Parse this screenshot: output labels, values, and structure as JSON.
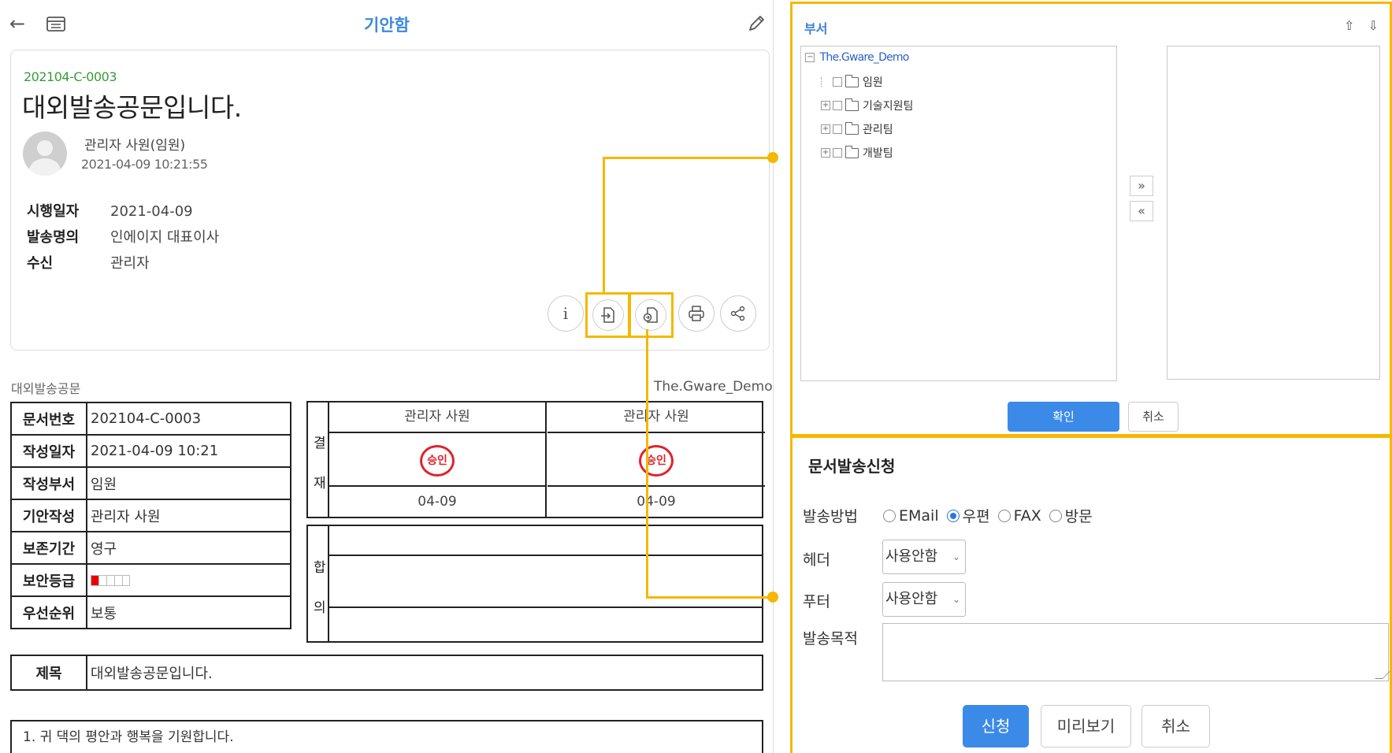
{
  "header": {
    "title": "기안함"
  },
  "document": {
    "code": "202104-C-0003",
    "title": "대외발송공문입니다.",
    "writer": "관리자 사원(임원)",
    "written_at": "2021-04-09 10:21:55",
    "meta": [
      {
        "key": "시행일자",
        "value": "2021-04-09"
      },
      {
        "key": "발송명의",
        "value": "인에이지 대표이사"
      },
      {
        "key": "수신",
        "value": "관리자"
      }
    ]
  },
  "form": {
    "label": "대외발송공문",
    "company": "The.Gware_Demo",
    "info_rows": [
      {
        "key": "문서번호",
        "value": "202104-C-0003"
      },
      {
        "key": "작성일자",
        "value": "2021-04-09 10:21"
      },
      {
        "key": "작성부서",
        "value": "임원"
      },
      {
        "key": "기안작성",
        "value": "관리자 사원"
      },
      {
        "key": "보존기간",
        "value": "영구"
      },
      {
        "key": "보안등급",
        "value": ""
      },
      {
        "key": "우선순위",
        "value": "보통"
      }
    ],
    "security_level": 1,
    "approval": {
      "side_label": [
        "결",
        "재"
      ],
      "columns": [
        {
          "name": "관리자 사원",
          "stamp": "승인",
          "date": "04-09"
        },
        {
          "name": "관리자 사원",
          "stamp": "승인",
          "date": "04-09"
        }
      ]
    },
    "agreement": {
      "side_label": [
        "합",
        "의"
      ]
    },
    "subject_key": "제목",
    "subject_value": "대외발송공문입니다.",
    "body_first_line": "1. 귀 댁의 평안과 행복을 기원합니다."
  },
  "dept_panel": {
    "title": "부서",
    "sort_arrows": "⇧ ⇩",
    "tree_root": "The.Gware_Demo",
    "tree_items": [
      "임원",
      "기술지원팀",
      "관리팀",
      "개발팀"
    ],
    "move_right": "»",
    "move_left": "«",
    "confirm_label": "확인",
    "cancel_label": "취소"
  },
  "send_panel": {
    "title": "문서발송신청",
    "method_label": "발송방법",
    "methods": [
      {
        "label": "EMail",
        "selected": false
      },
      {
        "label": "우편",
        "selected": true
      },
      {
        "label": "FAX",
        "selected": false
      },
      {
        "label": "방문",
        "selected": false
      }
    ],
    "header_label": "헤더",
    "header_value": "사용안함",
    "footer_label": "푸터",
    "footer_value": "사용안함",
    "purpose_label": "발송목적",
    "purpose_value": "",
    "submit_label": "신청",
    "preview_label": "미리보기",
    "cancel_label": "취소"
  },
  "colors": {
    "highlight": "#f5b800",
    "accent": "#3c8ae8",
    "stamp": "#e0232c",
    "code_green": "#3a9a3a"
  }
}
